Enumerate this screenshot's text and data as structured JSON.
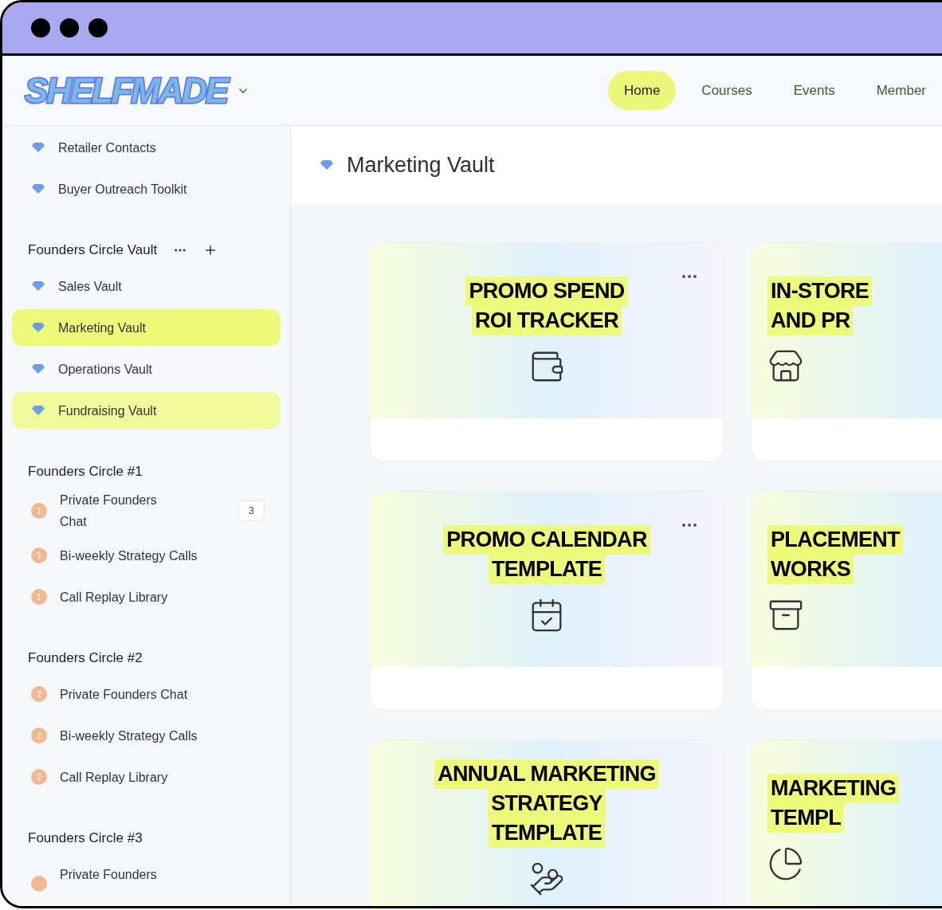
{
  "logo": {
    "text": "SHELFMADE"
  },
  "nav": [
    {
      "label": "Home",
      "selected": true
    },
    {
      "label": "Courses",
      "selected": false
    },
    {
      "label": "Events",
      "selected": false
    },
    {
      "label": "Member",
      "selected": false
    }
  ],
  "sidebar": {
    "sections": [
      {
        "items": [
          {
            "kind": "diamond",
            "label": "Retailer Contacts",
            "selected": false
          },
          {
            "kind": "diamond",
            "label": "Buyer Outreach Toolkit",
            "selected": false
          }
        ]
      },
      {
        "title": "Founders Circle Vault",
        "actions": true,
        "items": [
          {
            "kind": "diamond",
            "label": "Sales Vault",
            "selected": false
          },
          {
            "kind": "diamond",
            "label": "Marketing Vault",
            "selected": true
          },
          {
            "kind": "diamond",
            "label": "Operations Vault",
            "selected": false
          },
          {
            "kind": "diamond",
            "label": "Fundraising Vault",
            "selected": true
          }
        ]
      },
      {
        "title": "Founders Circle #1",
        "actions": false,
        "items": [
          {
            "kind": "number",
            "number": "1",
            "label": "Private Founders Chat",
            "count": "3",
            "selected": false
          },
          {
            "kind": "number",
            "number": "1",
            "label": "Bi-weekly Strategy Calls",
            "selected": false
          },
          {
            "kind": "number",
            "number": "1",
            "label": "Call Replay Library",
            "selected": false
          }
        ]
      },
      {
        "title": "Founders Circle #2",
        "actions": false,
        "items": [
          {
            "kind": "number",
            "number": "2",
            "label": "Private Founders Chat",
            "selected": false
          },
          {
            "kind": "number",
            "number": "2",
            "label": "Bi-weekly Strategy Calls",
            "selected": false
          },
          {
            "kind": "number",
            "number": "2",
            "label": "Call Replay Library",
            "selected": false
          }
        ]
      },
      {
        "title": "Founders Circle #3",
        "actions": false,
        "items": [
          {
            "kind": "dot",
            "label": "Private Founders",
            "selected": false
          }
        ]
      }
    ]
  },
  "page": {
    "title": "Marketing Vault"
  },
  "cards": [
    {
      "title_lines": [
        "PROMO SPEND",
        "ROI TRACKER"
      ],
      "menu": true
    },
    {
      "title_lines": [
        "IN-STORE",
        "AND PR"
      ],
      "menu": false
    },
    {
      "title_lines": [
        "PROMO CALENDAR",
        "TEMPLATE"
      ],
      "menu": true
    },
    {
      "title_lines": [
        "PLACEMENT",
        "WORKS"
      ],
      "menu": false
    },
    {
      "title_lines": [
        "ANNUAL MARKETING",
        "STRATEGY",
        "TEMPLATE"
      ],
      "menu": false
    },
    {
      "title_lines": [
        "MARKETING",
        "TEMPL"
      ],
      "menu": false
    }
  ]
}
